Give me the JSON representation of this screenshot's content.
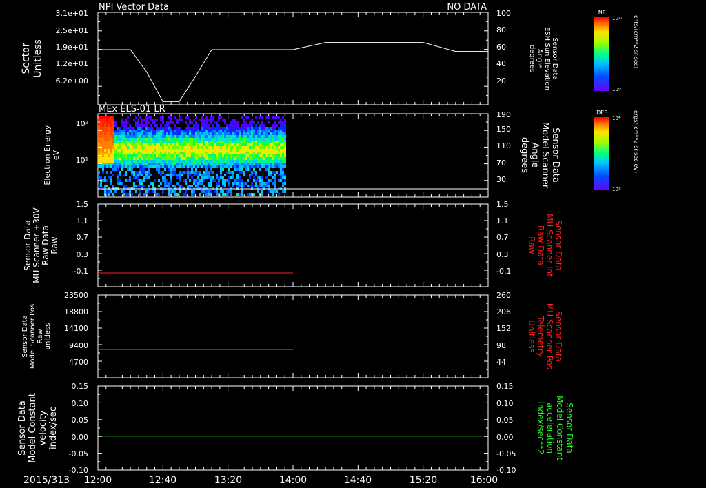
{
  "date_label": "2015/313",
  "x_ticks": [
    "12:00",
    "12:40",
    "13:20",
    "14:00",
    "14:40",
    "15:20",
    "16:00"
  ],
  "panels": [
    {
      "id": "p1",
      "title_left": "NPI Vector Data",
      "title_right": "NO DATA",
      "left_label": [
        "Sector",
        "Unitless"
      ],
      "left_ticks": [
        "3.1e+01",
        "2.5e+01",
        "1.9e+01",
        "1.2e+01",
        "6.2e+00"
      ],
      "right_label": [
        "Sensor Data",
        "ESH Sun Elevation",
        "Angle",
        "degrees"
      ],
      "right_ticks": [
        "100",
        "80",
        "60",
        "40",
        "20"
      ],
      "right_color": "#ffffff",
      "colorbar": {
        "title": "NF",
        "top": "10¹²",
        "bottom": "10⁶",
        "unit": "cnts/(cm**2-sr-sec)"
      }
    },
    {
      "id": "p2",
      "title_left": "MEx ELS-01 LR",
      "left_label": [
        "Electron Energy",
        "eV"
      ],
      "left_ticks": [
        "10²",
        "10¹"
      ],
      "right_label": [
        "Sensor Data",
        "Model Scanner",
        "Angle",
        "degrees"
      ],
      "right_ticks": [
        "190",
        "150",
        "110",
        "70",
        "30"
      ],
      "right_color": "#ffffff",
      "colorbar": {
        "title": "DEF",
        "top": "10⁴",
        "bottom": "10¹",
        "unit": "ergs/(cm**2-sr-sec-eV)"
      }
    },
    {
      "id": "p3",
      "left_label": [
        "Sensor Data",
        "MU Scanner +30V",
        "Raw Data",
        "Raw"
      ],
      "left_ticks": [
        "1.5",
        "1.1",
        "0.7",
        "0.3",
        "-0.1"
      ],
      "right_label": [
        "Sensor Data",
        "MU Scanner Int",
        "Raw Data",
        "Raw"
      ],
      "right_ticks": [
        "1.5",
        "1.1",
        "0.7",
        "0.3",
        "-0.1"
      ],
      "right_color": "#ff2020"
    },
    {
      "id": "p4",
      "left_label": [
        "Sensor Data",
        "Model Scanner Pos",
        "Raw",
        "unitless"
      ],
      "left_ticks": [
        "23500",
        "18800",
        "14100",
        "9400",
        "4700"
      ],
      "right_label": [
        "Sensor Data",
        "MU Scanner Pos",
        "Telemetry",
        "Unitless"
      ],
      "right_ticks": [
        "260",
        "206",
        "152",
        "98",
        "44"
      ],
      "right_color": "#ff2020"
    },
    {
      "id": "p5",
      "left_label": [
        "Sensor Data",
        "Model Constant",
        "velocity",
        "index/sec"
      ],
      "left_ticks": [
        "0.15",
        "0.10",
        "0.05",
        "0.00",
        "-0.05",
        "-0.10"
      ],
      "right_label": [
        "Sensor Data",
        "Model Constant",
        "acceleration",
        "index/sec**2"
      ],
      "right_ticks": [
        "0.15",
        "0.10",
        "0.05",
        "0.00",
        "-0.05",
        "-0.10"
      ],
      "right_color": "#20ff20"
    }
  ],
  "chart_data": [
    {
      "type": "line",
      "title": "NPI Vector Data",
      "xlabel": "2015/313",
      "ylabel": "Sensor Data ESH Sun Elevation Angle degrees",
      "ylim": [
        0,
        100
      ],
      "series": [
        {
          "x": [
            "12:00",
            "12:20",
            "12:30",
            "12:40",
            "12:50",
            "13:00",
            "13:10",
            "13:20",
            "13:40",
            "14:00",
            "14:20",
            "14:40",
            "15:00",
            "15:20",
            "15:40",
            "16:00"
          ],
          "values": [
            60,
            60,
            35,
            2,
            2,
            30,
            60,
            60,
            60,
            60,
            68,
            68,
            68,
            68,
            58,
            58
          ],
          "color": "#ffffff"
        }
      ]
    },
    {
      "type": "heatmap",
      "title": "MEx ELS-01 LR",
      "ylabel": "Electron Energy eV",
      "xrange": [
        "12:00",
        "13:55"
      ],
      "band_peak_eV": 20,
      "colorbar_range": [
        "10¹",
        "10⁴"
      ]
    },
    {
      "type": "line",
      "ylim": [
        -0.3,
        1.5
      ],
      "series": [
        {
          "x": [
            "12:00",
            "14:00"
          ],
          "values": [
            0.0,
            0.0
          ],
          "color": "#ff2020"
        }
      ]
    },
    {
      "type": "line",
      "ylim": [
        0,
        23500
      ],
      "series": [
        {
          "x": [
            "12:00",
            "14:00"
          ],
          "values": [
            8000,
            8000
          ],
          "color": "#ff2020"
        }
      ]
    },
    {
      "type": "line",
      "ylim": [
        -0.1,
        0.15
      ],
      "series": [
        {
          "x": [
            "12:00",
            "16:00"
          ],
          "values": [
            0.0,
            0.0
          ],
          "color": "#20ff20"
        }
      ]
    }
  ]
}
